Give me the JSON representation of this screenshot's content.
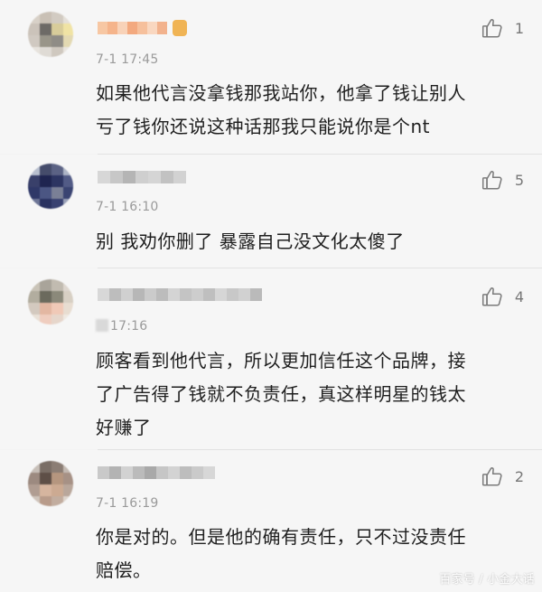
{
  "comments": [
    {
      "time": "7-1 17:45",
      "time_prefix_redacted": false,
      "text": "如果他代言没拿钱那我站你，他拿了钱让别人\n亏了钱你还说这种话那我只能说你是个nt",
      "likes": "1"
    },
    {
      "time": "7-1 16:10",
      "time_prefix_redacted": false,
      "text": "别 我劝你删了 暴露自己没文化太傻了",
      "likes": "5"
    },
    {
      "time": "17:16",
      "time_prefix_redacted": true,
      "text": "顾客看到他代言，所以更加信任这个品牌，接\n了广告得了钱就不负责任，真这样明星的钱太\n好赚了",
      "likes": "4"
    },
    {
      "time": "7-1 16:19",
      "time_prefix_redacted": false,
      "text": "你是对的。但是他的确有责任，只不过没责任\n赔偿。",
      "likes": "2"
    }
  ],
  "watermark": "百家号 / 小金大话",
  "icons": {
    "like": "thumbs-up-icon"
  },
  "colors": {
    "background": "#f3f3f3",
    "text": "#1f1f1f",
    "meta": "#9a9a9a",
    "icon": "#7b7b7b"
  }
}
